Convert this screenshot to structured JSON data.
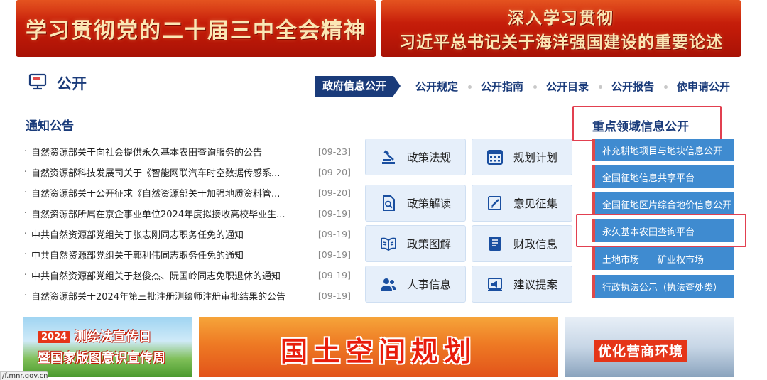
{
  "banners": {
    "left": "学习贯彻党的二十届三中全会精神",
    "right_line1": "深入学习贯彻",
    "right_line2": "习近平总书记关于海洋强国建设的重要论述"
  },
  "section": {
    "title": "公开",
    "tabs": [
      "政府信息公开",
      "公开规定",
      "公开指南",
      "公开目录",
      "公开报告",
      "依申请公开"
    ]
  },
  "notices": {
    "title": "通知公告",
    "items": [
      {
        "title": "自然资源部关于向社会提供永久基本农田查询服务的公告",
        "date": "[09-23]"
      },
      {
        "title": "自然资源部科技发展司关于《智能网联汽车时空数据传感系...",
        "date": "[09-20]"
      },
      {
        "title": "自然资源部关于公开征求《自然资源部关于加强地质资料管...",
        "date": "[09-20]"
      },
      {
        "title": "自然资源部所属在京企事业单位2024年度拟接收高校毕业生...",
        "date": "[09-19]"
      },
      {
        "title": "中共自然资源部党组关于张志刚同志职务任免的通知",
        "date": "[09-19]"
      },
      {
        "title": "中共自然资源部党组关于郭利伟同志职务任免的通知",
        "date": "[09-19]"
      },
      {
        "title": "中共自然资源部党组关于赵俊杰、阮国岭同志免职退休的通知",
        "date": "[09-19]"
      },
      {
        "title": "自然资源部关于2024年第三批注册测绘师注册审批结果的公告",
        "date": "[09-19]"
      }
    ]
  },
  "quick": [
    "政策法规",
    "规划计划",
    "政策解读",
    "意见征集",
    "政策图解",
    "财政信息",
    "人事信息",
    "建议提案"
  ],
  "key_areas": {
    "title": "重点领域信息公开",
    "items": [
      "补充耕地项目与地块信息公开",
      "全国征地信息共享平台",
      "全国征地区片综合地价信息公开",
      "永久基本农田查询平台",
      "土地市场",
      "矿业权市场",
      "行政执法公示（执法查处类）"
    ]
  },
  "bottom_banners": {
    "b1_year": "2024",
    "b1_line1": "测绘法宣传日",
    "b1_line2": "暨国家版图意识宣传周",
    "b2": "国土空间规划",
    "b3": "优化营商环境"
  },
  "status_url": "/f.mnr.gov.cn"
}
